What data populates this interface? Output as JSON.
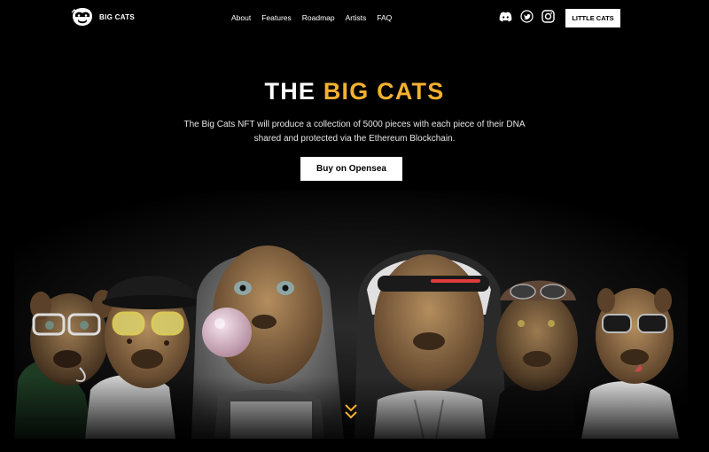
{
  "brand": {
    "name": "BIG CATS",
    "logo_icon": "gorilla-head-icon"
  },
  "nav": {
    "items": [
      "About",
      "Features",
      "Roadmap",
      "Artists",
      "FAQ"
    ]
  },
  "socials": [
    {
      "name": "discord",
      "icon": "discord-icon"
    },
    {
      "name": "twitter",
      "icon": "twitter-icon"
    },
    {
      "name": "instagram",
      "icon": "instagram-icon"
    }
  ],
  "header_cta": {
    "label": "LITTLE CATS"
  },
  "hero": {
    "title_main": "THE",
    "title_accent": "BIG CATS",
    "description": "The Big Cats NFT will produce a collection of 5000 pieces with each piece of their DNA shared and protected via the Ethereum Blockchain.",
    "button_label": "Buy on Opensea",
    "accent_color": "#f5b12e"
  },
  "scroll_indicator": {
    "icon": "double-chevron-down-icon"
  }
}
